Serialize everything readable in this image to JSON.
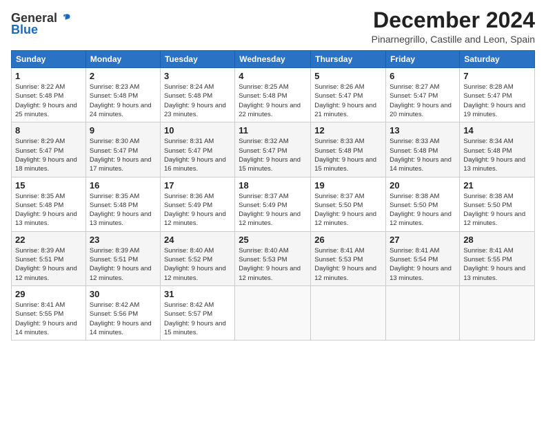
{
  "header": {
    "logo_general": "General",
    "logo_blue": "Blue",
    "month_title": "December 2024",
    "location": "Pinarnegrillo, Castille and Leon, Spain"
  },
  "weekdays": [
    "Sunday",
    "Monday",
    "Tuesday",
    "Wednesday",
    "Thursday",
    "Friday",
    "Saturday"
  ],
  "weeks": [
    [
      {
        "day": "1",
        "sunrise": "Sunrise: 8:22 AM",
        "sunset": "Sunset: 5:48 PM",
        "daylight": "Daylight: 9 hours and 25 minutes."
      },
      {
        "day": "2",
        "sunrise": "Sunrise: 8:23 AM",
        "sunset": "Sunset: 5:48 PM",
        "daylight": "Daylight: 9 hours and 24 minutes."
      },
      {
        "day": "3",
        "sunrise": "Sunrise: 8:24 AM",
        "sunset": "Sunset: 5:48 PM",
        "daylight": "Daylight: 9 hours and 23 minutes."
      },
      {
        "day": "4",
        "sunrise": "Sunrise: 8:25 AM",
        "sunset": "Sunset: 5:48 PM",
        "daylight": "Daylight: 9 hours and 22 minutes."
      },
      {
        "day": "5",
        "sunrise": "Sunrise: 8:26 AM",
        "sunset": "Sunset: 5:47 PM",
        "daylight": "Daylight: 9 hours and 21 minutes."
      },
      {
        "day": "6",
        "sunrise": "Sunrise: 8:27 AM",
        "sunset": "Sunset: 5:47 PM",
        "daylight": "Daylight: 9 hours and 20 minutes."
      },
      {
        "day": "7",
        "sunrise": "Sunrise: 8:28 AM",
        "sunset": "Sunset: 5:47 PM",
        "daylight": "Daylight: 9 hours and 19 minutes."
      }
    ],
    [
      {
        "day": "8",
        "sunrise": "Sunrise: 8:29 AM",
        "sunset": "Sunset: 5:47 PM",
        "daylight": "Daylight: 9 hours and 18 minutes."
      },
      {
        "day": "9",
        "sunrise": "Sunrise: 8:30 AM",
        "sunset": "Sunset: 5:47 PM",
        "daylight": "Daylight: 9 hours and 17 minutes."
      },
      {
        "day": "10",
        "sunrise": "Sunrise: 8:31 AM",
        "sunset": "Sunset: 5:47 PM",
        "daylight": "Daylight: 9 hours and 16 minutes."
      },
      {
        "day": "11",
        "sunrise": "Sunrise: 8:32 AM",
        "sunset": "Sunset: 5:47 PM",
        "daylight": "Daylight: 9 hours and 15 minutes."
      },
      {
        "day": "12",
        "sunrise": "Sunrise: 8:33 AM",
        "sunset": "Sunset: 5:48 PM",
        "daylight": "Daylight: 9 hours and 15 minutes."
      },
      {
        "day": "13",
        "sunrise": "Sunrise: 8:33 AM",
        "sunset": "Sunset: 5:48 PM",
        "daylight": "Daylight: 9 hours and 14 minutes."
      },
      {
        "day": "14",
        "sunrise": "Sunrise: 8:34 AM",
        "sunset": "Sunset: 5:48 PM",
        "daylight": "Daylight: 9 hours and 13 minutes."
      }
    ],
    [
      {
        "day": "15",
        "sunrise": "Sunrise: 8:35 AM",
        "sunset": "Sunset: 5:48 PM",
        "daylight": "Daylight: 9 hours and 13 minutes."
      },
      {
        "day": "16",
        "sunrise": "Sunrise: 8:35 AM",
        "sunset": "Sunset: 5:48 PM",
        "daylight": "Daylight: 9 hours and 13 minutes."
      },
      {
        "day": "17",
        "sunrise": "Sunrise: 8:36 AM",
        "sunset": "Sunset: 5:49 PM",
        "daylight": "Daylight: 9 hours and 12 minutes."
      },
      {
        "day": "18",
        "sunrise": "Sunrise: 8:37 AM",
        "sunset": "Sunset: 5:49 PM",
        "daylight": "Daylight: 9 hours and 12 minutes."
      },
      {
        "day": "19",
        "sunrise": "Sunrise: 8:37 AM",
        "sunset": "Sunset: 5:50 PM",
        "daylight": "Daylight: 9 hours and 12 minutes."
      },
      {
        "day": "20",
        "sunrise": "Sunrise: 8:38 AM",
        "sunset": "Sunset: 5:50 PM",
        "daylight": "Daylight: 9 hours and 12 minutes."
      },
      {
        "day": "21",
        "sunrise": "Sunrise: 8:38 AM",
        "sunset": "Sunset: 5:50 PM",
        "daylight": "Daylight: 9 hours and 12 minutes."
      }
    ],
    [
      {
        "day": "22",
        "sunrise": "Sunrise: 8:39 AM",
        "sunset": "Sunset: 5:51 PM",
        "daylight": "Daylight: 9 hours and 12 minutes."
      },
      {
        "day": "23",
        "sunrise": "Sunrise: 8:39 AM",
        "sunset": "Sunset: 5:51 PM",
        "daylight": "Daylight: 9 hours and 12 minutes."
      },
      {
        "day": "24",
        "sunrise": "Sunrise: 8:40 AM",
        "sunset": "Sunset: 5:52 PM",
        "daylight": "Daylight: 9 hours and 12 minutes."
      },
      {
        "day": "25",
        "sunrise": "Sunrise: 8:40 AM",
        "sunset": "Sunset: 5:53 PM",
        "daylight": "Daylight: 9 hours and 12 minutes."
      },
      {
        "day": "26",
        "sunrise": "Sunrise: 8:41 AM",
        "sunset": "Sunset: 5:53 PM",
        "daylight": "Daylight: 9 hours and 12 minutes."
      },
      {
        "day": "27",
        "sunrise": "Sunrise: 8:41 AM",
        "sunset": "Sunset: 5:54 PM",
        "daylight": "Daylight: 9 hours and 13 minutes."
      },
      {
        "day": "28",
        "sunrise": "Sunrise: 8:41 AM",
        "sunset": "Sunset: 5:55 PM",
        "daylight": "Daylight: 9 hours and 13 minutes."
      }
    ],
    [
      {
        "day": "29",
        "sunrise": "Sunrise: 8:41 AM",
        "sunset": "Sunset: 5:55 PM",
        "daylight": "Daylight: 9 hours and 14 minutes."
      },
      {
        "day": "30",
        "sunrise": "Sunrise: 8:42 AM",
        "sunset": "Sunset: 5:56 PM",
        "daylight": "Daylight: 9 hours and 14 minutes."
      },
      {
        "day": "31",
        "sunrise": "Sunrise: 8:42 AM",
        "sunset": "Sunset: 5:57 PM",
        "daylight": "Daylight: 9 hours and 15 minutes."
      },
      null,
      null,
      null,
      null
    ]
  ]
}
